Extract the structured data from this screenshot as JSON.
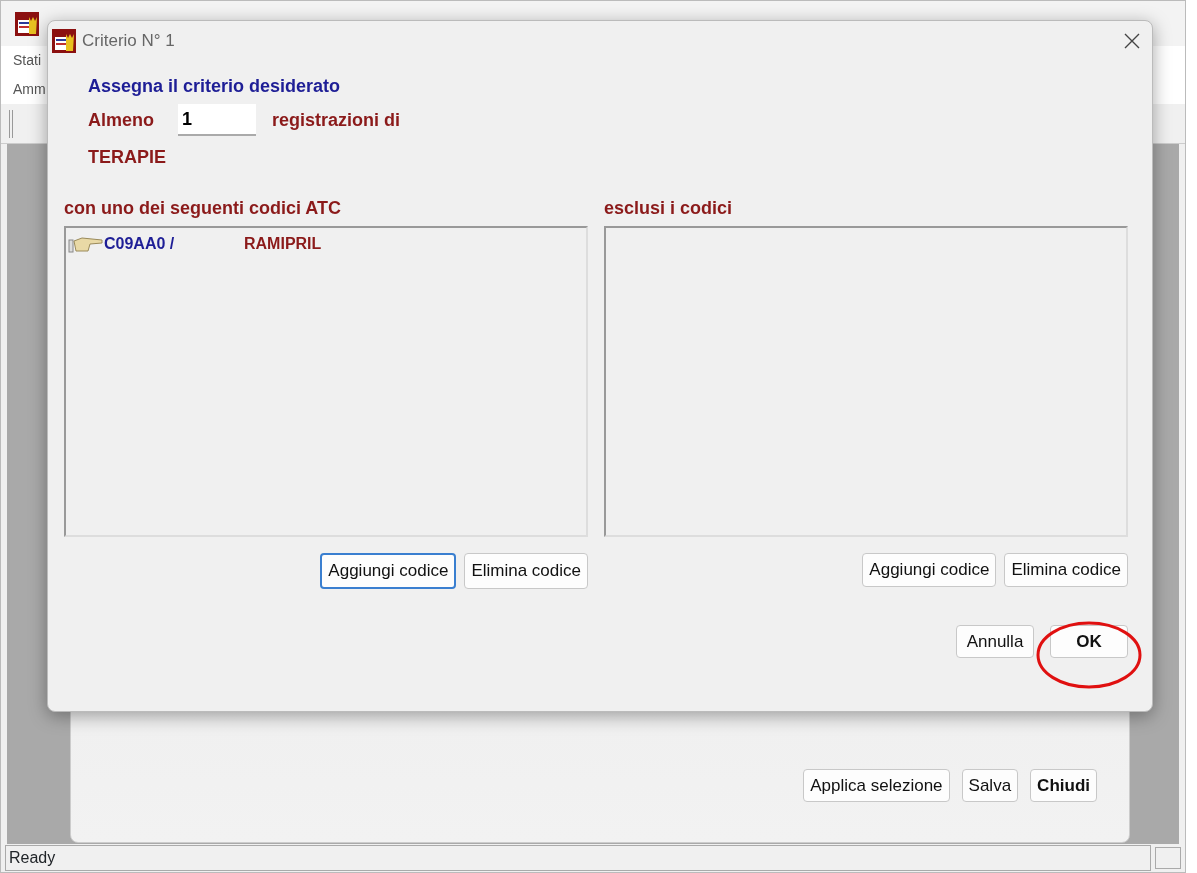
{
  "main_window": {
    "menu": [
      "Stati",
      "Amm"
    ],
    "status_bar": "Ready"
  },
  "back_window": {
    "buttons": [
      {
        "label": "Applica selezione",
        "bold": false
      },
      {
        "label": "Salva",
        "bold": false
      },
      {
        "label": "Chiudi",
        "bold": true
      }
    ]
  },
  "dialog": {
    "title": "Criterio N° 1",
    "heading": "Assegna il criterio desiderato",
    "count_label": "Almeno",
    "count_value": "1",
    "count_suffix": "registrazioni di",
    "category": "TERAPIE",
    "lists": [
      {
        "label": "con uno dei seguenti codici ATC",
        "items": [
          {
            "code": "C09AA0",
            "separator": "/",
            "name": "RAMIPRIL"
          }
        ],
        "buttons": [
          {
            "label": "Aggiungi codice",
            "focused": true
          },
          {
            "label": "Elimina codice",
            "focused": false
          }
        ]
      },
      {
        "label": "esclusi i codici",
        "buttons": [
          {
            "label": "Aggiungi codice",
            "focused": false
          },
          {
            "label": "Elimina codice",
            "focused": false
          }
        ]
      }
    ],
    "footer_buttons": [
      {
        "label": "Annulla",
        "circled": false
      },
      {
        "label": "OK",
        "circled": true
      }
    ]
  }
}
